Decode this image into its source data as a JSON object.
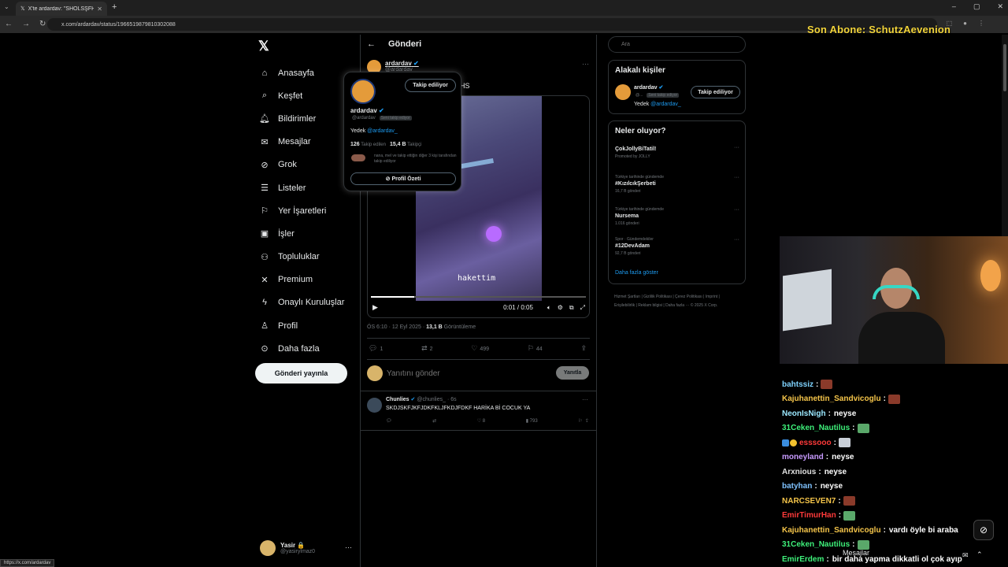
{
  "browser": {
    "tab_title": "X'te ardardav: \"SHÖLSŞFHFSMF\"",
    "url": "x.com/ardardav/status/1966519879810302088",
    "status_url": "https://x.com/ardardav"
  },
  "stream_overlay": {
    "top_text": "Son Abone: SchutzAevenion"
  },
  "nav": {
    "items": [
      {
        "label": "Anasayfa",
        "icon": "home-icon",
        "glyph": "⌂"
      },
      {
        "label": "Keşfet",
        "icon": "search-icon",
        "glyph": "⌕"
      },
      {
        "label": "Bildirimler",
        "icon": "bell-icon",
        "glyph": "🔔︎"
      },
      {
        "label": "Mesajlar",
        "icon": "envelope-icon",
        "glyph": "✉"
      },
      {
        "label": "Grok",
        "icon": "grok-icon",
        "glyph": "⊘"
      },
      {
        "label": "Listeler",
        "icon": "list-icon",
        "glyph": "☰"
      },
      {
        "label": "Yer İşaretleri",
        "icon": "bookmark-icon",
        "glyph": "⚐"
      },
      {
        "label": "İşler",
        "icon": "briefcase-icon",
        "glyph": "▣"
      },
      {
        "label": "Topluluklar",
        "icon": "communities-icon",
        "glyph": "⚇"
      },
      {
        "label": "Premium",
        "icon": "x-icon",
        "glyph": "✕"
      },
      {
        "label": "Onaylı Kuruluşlar",
        "icon": "lightning-icon",
        "glyph": "ϟ"
      },
      {
        "label": "Profil",
        "icon": "person-icon",
        "glyph": "♙"
      },
      {
        "label": "Daha fazla",
        "icon": "more-circle-icon",
        "glyph": "⊙"
      }
    ],
    "post_button": "Gönderi yayınla",
    "account": {
      "name": "Yasir 🔒",
      "handle": "@yasirylmaz0"
    }
  },
  "post": {
    "header_title": "Gönderi",
    "author_name": "ardardav",
    "author_handle": "@ardardav",
    "text_visible": "HS",
    "video": {
      "caption": "hakettim",
      "time": "0:01 / 0:05",
      "progress_fraction": 0.2
    },
    "timestamp": "ÖS 6:10 · 12 Eyl 2025 · ",
    "views_count": "13,1 B",
    "views_label": " Görüntüleme",
    "actions": {
      "replies": "1",
      "reposts": "2",
      "likes": "499",
      "bookmarks": "44"
    },
    "reply_placeholder": "Yanıtını gönder",
    "reply_button": "Yanıtla"
  },
  "reply": {
    "name": "Chunlies",
    "handle": "@chunlies_ · 6s",
    "text": "SKDJSKFJKFJDKFKLJFKDJFDKF HARİKA Bİ COCUK YA",
    "likes": "8",
    "views": "793"
  },
  "hover_card": {
    "name": "ardardav",
    "handle": "@ardardav",
    "follows_you": "Seni takip ediyor",
    "follow_button": "Takip ediliyor",
    "bio_prefix": "Yedek ",
    "bio_link": "@ardardav_",
    "following_count": "126",
    "following_label": " Takip edilen",
    "followers_count": "15,4 B",
    "followers_label": " Takipçi",
    "mutual": "nana, mel ve takip ettiğin diğer 3 kişi tarafından takip ediliyor",
    "summary_button": "Profil Özeti"
  },
  "right": {
    "search_placeholder": "Ara",
    "relevant_title": "Alakalı kişiler",
    "relevant_name": "ardardav",
    "relevant_handle": "@...",
    "relevant_follows_you": "Seni takip ediyor",
    "relevant_bio_prefix": "Yedek ",
    "relevant_bio_link": "@ardardav_",
    "relevant_button": "Takip ediliyor",
    "trends_title": "Neler oluyor?",
    "trends": [
      {
        "context": "",
        "title": "ÇokJollyBiTatil!",
        "count": "Promoted by JOLLY"
      },
      {
        "context": "Türkiye tarihinde gündemde",
        "title": "#KızılcıkŞerbeti",
        "count": "16,7 B gönderi"
      },
      {
        "context": "Türkiye tarihinde gündemde",
        "title": "Nursema",
        "count": "1.016 gönderi"
      },
      {
        "context": "Spor · Gündemdekiler",
        "title": "#12DevAdam",
        "count": "92,7 B gönderi"
      }
    ],
    "show_more": "Daha fazla göster",
    "footer": "Hizmet Şartları  |  Gizlilik Politikası  |  Çerez Politikası  |  Imprint  |  Erişilebilirlik  |  Reklam bilgisi  |  Daha fazla ···  © 2025 X Corp."
  },
  "chat": {
    "messages": [
      {
        "user": "bahtssiz",
        "color": "#7fd3ff",
        "text": "",
        "emote": "#8a3a2a"
      },
      {
        "user": "Kajuhanettin_Sandvicoglu",
        "color": "#f5c54a",
        "text": "",
        "emote": "#8a3a2a"
      },
      {
        "user": "NeonIsNigh",
        "color": "#9be8ff",
        "text": "neyse",
        "emote": ""
      },
      {
        "user": "31Ceken_Nautilus",
        "color": "#3ef07a",
        "text": "",
        "emote": "#5aa86a"
      },
      {
        "user": "esssooo",
        "color": "#ff3a3a",
        "text": "",
        "emote": "#c9cfd8"
      },
      {
        "user": "moneyland",
        "color": "#c89bff",
        "text": "neyse",
        "emote": ""
      },
      {
        "user": "Arxnious",
        "color": "#e0e0e0",
        "text": "neyse",
        "emote": ""
      },
      {
        "user": "batyhan",
        "color": "#7fc2ff",
        "text": "neyse",
        "emote": ""
      },
      {
        "user": "NARCSEVEN7",
        "color": "#f5c54a",
        "text": "",
        "emote": "#8a3a2a"
      },
      {
        "user": "EmirTimurHan",
        "color": "#ff3a3a",
        "text": "",
        "emote": "#5aa86a"
      },
      {
        "user": "Kajuhanettin_Sandvicoglu",
        "color": "#f5c54a",
        "text": "vardı öyle bi araba",
        "emote": ""
      },
      {
        "user": "31Ceken_Nautilus",
        "color": "#3ef07a",
        "text": "",
        "emote": "#5aa86a"
      },
      {
        "user": "EmirErdem",
        "color": "#3ef07a",
        "text": "bir daha yapma dikkatli ol çok ayıp",
        "emote": ""
      }
    ],
    "dm_label": "Mesajlar"
  }
}
